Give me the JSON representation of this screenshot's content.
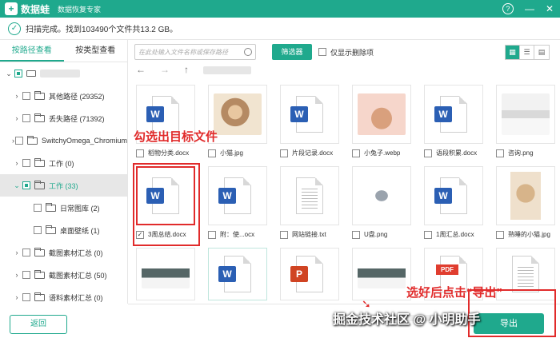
{
  "app": {
    "name": "数据蛙",
    "subtitle": "数据恢复专家",
    "logo_char": "+"
  },
  "window_controls": {
    "help": "?",
    "minimize": "—",
    "close": "✕"
  },
  "status": {
    "text": "扫描完成。找到103490个文件共13.2 GB。",
    "icon": "check-circle-icon"
  },
  "sidebar": {
    "tabs": [
      {
        "label": "按路径查看",
        "active": true
      },
      {
        "label": "按类型查看",
        "active": false
      }
    ],
    "items": [
      {
        "label": "其他路径 (29352)"
      },
      {
        "label": "丢失路径 (71392)"
      },
      {
        "label": "SwitchyOmega_Chromium"
      },
      {
        "label": "工作 (0)"
      },
      {
        "label": "工作 (33)"
      },
      {
        "label": "日常图库 (2)"
      },
      {
        "label": "桌面壁纸 (1)"
      },
      {
        "label": "截图素材汇总 (0)"
      },
      {
        "label": "截图素材汇总 (50)"
      },
      {
        "label": "语料素材汇总 (0)"
      }
    ]
  },
  "toolbar": {
    "search_placeholder": "在此处输入文件名称或保存路径",
    "filter_label": "筛选器",
    "only_deleted_label": "仅显示删除项"
  },
  "files": [
    {
      "name": "稻物分类.docx",
      "type": "word"
    },
    {
      "name": "小猫.jpg",
      "type": "image-cat"
    },
    {
      "name": "片段记录.docx",
      "type": "word"
    },
    {
      "name": "小兔子.webp",
      "type": "image-bunny"
    },
    {
      "name": "语段积累.docx",
      "type": "word"
    },
    {
      "name": "咨询.png",
      "type": "image-office"
    },
    {
      "name": "3周总结.docx",
      "type": "word",
      "checked": true
    },
    {
      "name": "附：使...ocx",
      "type": "word"
    },
    {
      "name": "网站链接.txt",
      "type": "txt"
    },
    {
      "name": "U盘.png",
      "type": "image-usb"
    },
    {
      "name": "1周汇总.docx",
      "type": "word"
    },
    {
      "name": "熟睡的小猫.jpg",
      "type": "image-kitten"
    }
  ],
  "annotations": {
    "select_hint": "勾选出目标文件",
    "export_hint": "选好后点击“导出”"
  },
  "footer": {
    "back_label": "返回",
    "export_label": "导出",
    "watermark": "掘金技术社区 @ 小明助手"
  },
  "colors": {
    "brand": "#1fa98d",
    "annotation": "#e12b2b",
    "word": "#2b5fb4",
    "ppt": "#d04423",
    "pdf": "#e03d2f"
  }
}
